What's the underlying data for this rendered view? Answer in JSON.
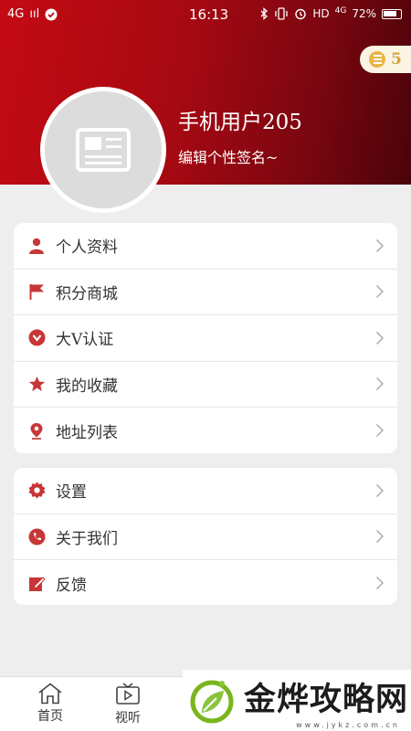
{
  "status_bar": {
    "carrier": "4G",
    "signal_text": "ııl",
    "time": "16:13",
    "network": "HD",
    "network_gen": "4G",
    "battery": "72%"
  },
  "header": {
    "username": "手机用户205",
    "signature": "编辑个性签名~",
    "coin_count": "5",
    "accent_color": "#c40a14"
  },
  "menu_primary": [
    {
      "label": "个人资料",
      "icon": "person-icon"
    },
    {
      "label": "积分商城",
      "icon": "flag-icon"
    },
    {
      "label": "大V认证",
      "icon": "verified-icon"
    },
    {
      "label": "我的收藏",
      "icon": "star-icon"
    },
    {
      "label": "地址列表",
      "icon": "location-pin-icon"
    }
  ],
  "menu_secondary": [
    {
      "label": "设置",
      "icon": "gear-icon"
    },
    {
      "label": "关于我们",
      "icon": "phone-icon"
    },
    {
      "label": "反馈",
      "icon": "edit-icon"
    }
  ],
  "tabbar": {
    "home_label": "首页",
    "video_label": "视听"
  },
  "watermark": {
    "text": "金烨攻略网",
    "url": "www.jykz.com.cn"
  }
}
